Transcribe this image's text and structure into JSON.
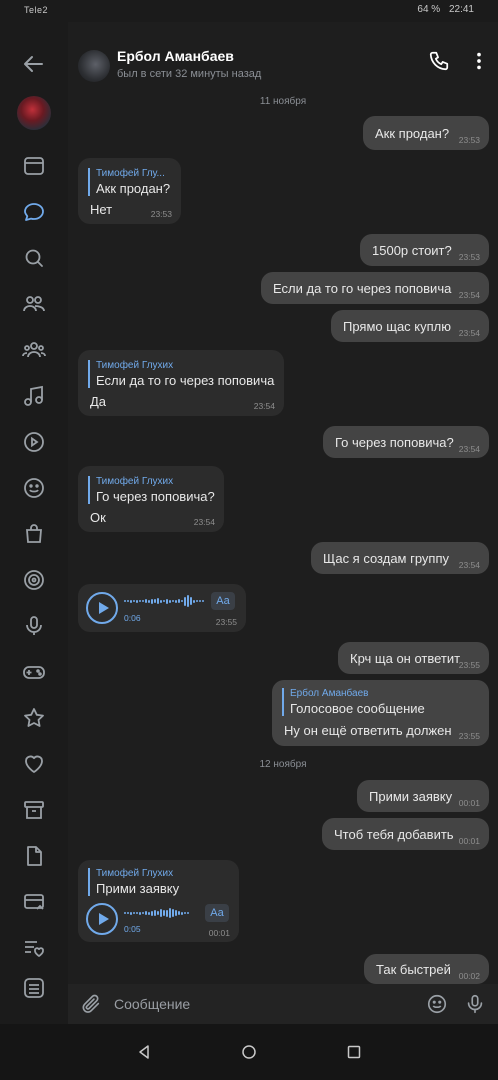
{
  "status_bar": {
    "carrier": "Tele2",
    "battery": "64 %",
    "time": "22:41"
  },
  "header": {
    "contact_name": "Ербол Аманбаев",
    "last_seen": "был в сети 32 минуты назад"
  },
  "rail_icons": [
    "back-icon",
    "avatar",
    "news-icon",
    "messages-icon",
    "search-icon",
    "friends-icon",
    "communities-icon",
    "music-icon",
    "video-icon",
    "emoji-icon",
    "market-icon",
    "clips-icon",
    "podcasts-icon",
    "games-icon",
    "favorites-icon",
    "likes-icon",
    "archive-icon",
    "documents-icon",
    "payments-icon",
    "lists-icon",
    "more-icon"
  ],
  "chat": {
    "date1": "11 ноября",
    "date2": "12 ноября",
    "messages": [
      {
        "dir": "out",
        "text": "Акк продан?",
        "time": "23:53"
      },
      {
        "dir": "in",
        "reply_name": "Тимофей Глу...",
        "reply_text": "Акк продан?",
        "text": "Нет",
        "time": "23:53"
      },
      {
        "dir": "out",
        "text": "1500р стоит?",
        "time": "23:53"
      },
      {
        "dir": "out",
        "text": "Если да то го через поповича",
        "time": "23:54"
      },
      {
        "dir": "out",
        "text": "Прямо щас куплю",
        "time": "23:54"
      },
      {
        "dir": "in",
        "reply_name": "Тимофей Глухих",
        "reply_text": "Если да то го через поповича",
        "text": "Да",
        "time": "23:54"
      },
      {
        "dir": "out",
        "text": "Го через поповича?",
        "time": "23:54"
      },
      {
        "dir": "in",
        "reply_name": "Тимофей Глухих",
        "reply_text": "Го через поповича?",
        "text": "Ок",
        "time": "23:54"
      },
      {
        "dir": "out",
        "text": "Щас я создам группу",
        "time": "23:54"
      },
      {
        "dir": "in",
        "voice_duration": "0:06",
        "aa": "Aa",
        "time": "23:55"
      },
      {
        "dir": "out",
        "text": "Крч ща он ответит",
        "time": "23:55"
      },
      {
        "dir": "out",
        "reply_name": "Ербол Аманбаев",
        "reply_text": "Голосовое сообщение",
        "text": "Ну он ещё ответить должен",
        "time": "23:55"
      },
      {
        "dir": "out",
        "text": "Прими заявку",
        "time": "00:01"
      },
      {
        "dir": "out",
        "text": "Чтоб тебя добавить",
        "time": "00:01"
      },
      {
        "dir": "in",
        "reply_name": "Тимофей Глухих",
        "reply_text": "Прими заявку",
        "voice_duration": "0:05",
        "aa": "Aa",
        "time": "00:01"
      },
      {
        "dir": "out",
        "text": "Так быстрей",
        "time": "00:02"
      }
    ]
  },
  "composer": {
    "placeholder": "Сообщение"
  },
  "colors": {
    "accent": "#71aaeb",
    "background": "#1e1e1e",
    "outgoing_bubble": "#444444",
    "incoming_bubble": "#2c2c2c"
  }
}
